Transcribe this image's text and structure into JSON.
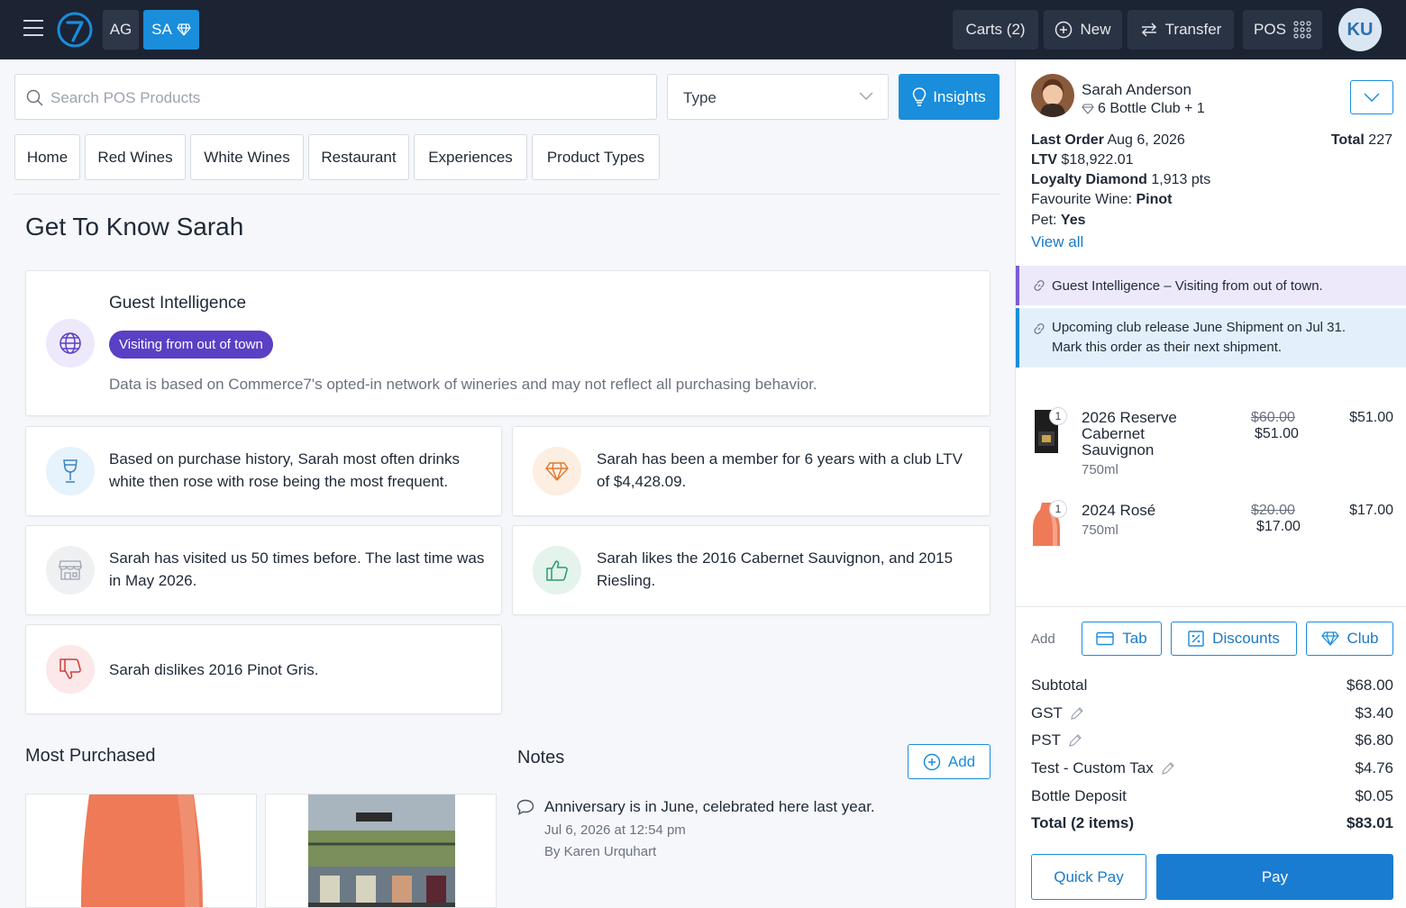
{
  "topbar": {
    "badge_ag": "AG",
    "badge_sa": "SA",
    "carts": "Carts (2)",
    "new": "New",
    "transfer": "Transfer",
    "pos": "POS",
    "avatar": "KU"
  },
  "search": {
    "placeholder": "Search POS Products"
  },
  "type_select": {
    "value": "Type"
  },
  "insights_label": "Insights",
  "tabs": [
    "Home",
    "Red Wines",
    "White Wines",
    "Restaurant",
    "Experiences",
    "Product Types"
  ],
  "page_title": "Get To Know Sarah",
  "guest_intelligence": {
    "title": "Guest Intelligence",
    "pill": "Visiting from out of town",
    "note": "Data is based on Commerce7's opted-in network of wineries and may not reflect all purchasing behavior."
  },
  "insight_cards": [
    {
      "icon": "wine-glass-icon",
      "text": "Based on purchase history, Sarah most often drinks white then rose with rose being the most frequent."
    },
    {
      "icon": "diamond-icon",
      "text": "Sarah has been a member for 6 years with a club LTV of $4,428.09."
    },
    {
      "icon": "store-icon",
      "text": "Sarah has visited us 50 times before. The last time was in May 2026."
    },
    {
      "icon": "thumbs-up-icon",
      "text": "Sarah likes the 2016 Cabernet Sauvignon, and 2015 Riesling."
    },
    {
      "icon": "thumbs-down-icon",
      "text": "Sarah dislikes 2016 Pinot Gris."
    }
  ],
  "most_purchased": {
    "title": "Most Purchased"
  },
  "notes": {
    "title": "Notes",
    "add_label": "Add",
    "items": [
      {
        "text": "Anniversary is in June, celebrated here last year.",
        "date": "Jul 6, 2026 at 12:54 pm",
        "author": "By Karen Urquhart"
      }
    ]
  },
  "customer": {
    "name": "Sarah Anderson",
    "club": "6 Bottle Club + 1",
    "last_order_label": "Last Order",
    "last_order_value": "Aug 6, 2026",
    "total_label": "Total",
    "total_value": "227",
    "ltv_label": "LTV",
    "ltv_value": "$18,922.01",
    "loyalty_label": "Loyalty Diamond",
    "loyalty_value": "1,913 pts",
    "fav_label": "Favourite Wine:",
    "fav_value": "Pinot",
    "pet_label": "Pet:",
    "pet_value": "Yes",
    "view_all": "View all"
  },
  "alerts": [
    {
      "text": "Guest Intelligence – Visiting from out of town.",
      "color": "#ede9fb",
      "accent": "#7c5cd6"
    },
    {
      "text_line1": "Upcoming club release June Shipment on Jul 31.",
      "text_line2": "Mark this order as their next shipment.",
      "color": "#e3f0fb",
      "accent": "#1a8ddb"
    }
  ],
  "cart_items": [
    {
      "qty": "1",
      "name_line1": "2026 Reserve",
      "name_line2": "Cabernet",
      "name_line3": "Sauvignon",
      "size": "750ml",
      "price_original": "$60.00",
      "price_discounted": "$51.00",
      "line_total": "$51.00"
    },
    {
      "qty": "1",
      "name_line1": "2024 Rosé",
      "size": "750ml",
      "price_original": "$20.00",
      "price_discounted": "$17.00",
      "line_total": "$17.00"
    }
  ],
  "add_row": {
    "label": "Add",
    "tab": "Tab",
    "discounts": "Discounts",
    "club": "Club"
  },
  "summary": [
    {
      "label": "Subtotal",
      "value": "$68.00"
    },
    {
      "label": "GST",
      "value": "$3.40"
    },
    {
      "label": "PST",
      "value": "$6.80"
    },
    {
      "label": "Test - Custom Tax",
      "value": "$4.76"
    },
    {
      "label": "Bottle Deposit",
      "value": "$0.05"
    },
    {
      "label": "Total (2 items)",
      "value": "$83.01"
    }
  ],
  "quick_pay": "Quick Pay",
  "pay": "Pay",
  "colors": {
    "brand_blue": "#1a8ddb",
    "topbar_bg": "#1c2434",
    "pill_purple": "#5b3fc4"
  }
}
